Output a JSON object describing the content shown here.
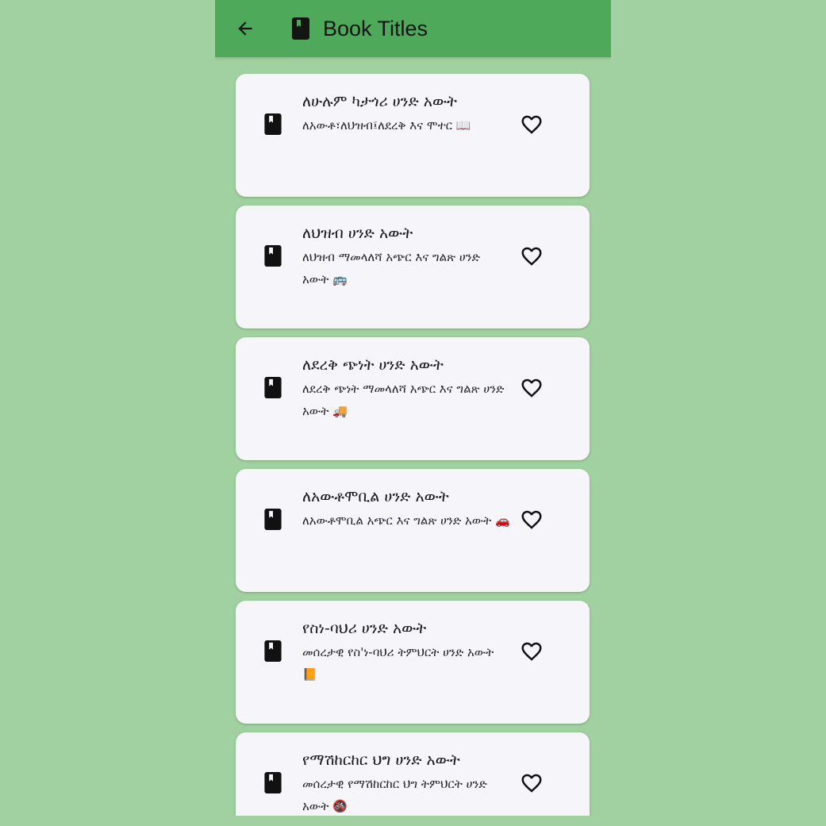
{
  "app_bar": {
    "back_icon": "arrow-back-icon",
    "title_icon": "book-icon",
    "title": "Book Titles"
  },
  "books": [
    {
      "title": "ለሁሉም ካታጎሪ ሀንድ አውት",
      "subtitle": "ለአውቶ፣ለህዝብ፤ለደረቅ እና ሞተር 📖",
      "leading_icon": "book-icon",
      "trailing_icon": "heart-outline-icon"
    },
    {
      "title": "ለህዝብ ሀንድ አውት",
      "subtitle": "ለህዝብ ማመላለሻ አጭር እና ግልጽ ሀንድ አውት 🚌",
      "leading_icon": "book-icon",
      "trailing_icon": "heart-outline-icon"
    },
    {
      "title": "ለደረቅ ጭነት ሀንድ አውት",
      "subtitle": "ለደረቅ ጭነት ማመላለሻ አጭር እና ግልጽ ሀንድ አውት 🚚",
      "leading_icon": "book-icon",
      "trailing_icon": "heart-outline-icon"
    },
    {
      "title": "ለአውቶሞቢል ሀንድ አውት",
      "subtitle": "ለአውቶሞቢል አጭር እና ግልጽ ሀንድ አውት 🚗",
      "leading_icon": "book-icon",
      "trailing_icon": "heart-outline-icon"
    },
    {
      "title": "የስነ-ባህሪ ሀንድ አውት",
      "subtitle": "መሰረታዊ የስ'ነ-ባህሪ ትምህርት ሀንድ አውት 📙",
      "leading_icon": "book-icon",
      "trailing_icon": "heart-outline-icon"
    },
    {
      "title": "የማሽከርከር ህግ ሀንድ አውት",
      "subtitle": "መሰረታዊ የማሽከርከር ህግ ትምህርት ሀንድ አውት 🚳",
      "leading_icon": "book-icon",
      "trailing_icon": "heart-outline-icon"
    }
  ],
  "colors": {
    "app_bar": "#4ea95a",
    "background": "#a1d1a0",
    "card": "#f6f5f9"
  }
}
